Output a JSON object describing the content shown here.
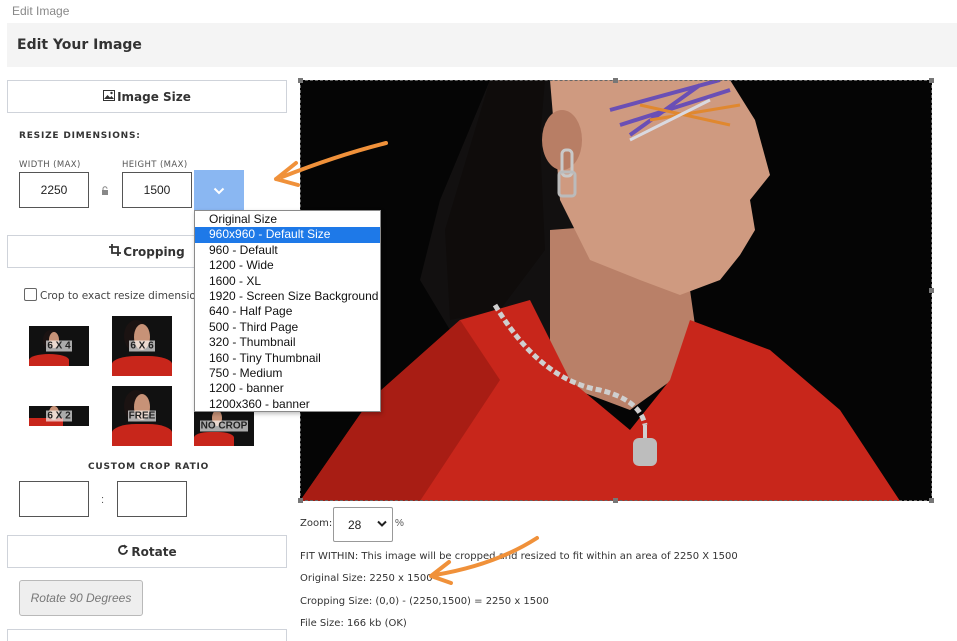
{
  "window": {
    "title": "Edit Image"
  },
  "header": {
    "title": "Edit Your Image"
  },
  "image_size": {
    "button_label": "Image Size"
  },
  "resize": {
    "heading": "RESIZE DIMENSIONS:",
    "width_label": "WIDTH (MAX)",
    "height_label": "HEIGHT (MAX)",
    "width_value": "2250",
    "height_value": "1500"
  },
  "presets": {
    "selected": "960x960 - Default Size",
    "options": [
      "Original Size",
      "960x960 - Default Size",
      "960 - Default",
      "1200 - Wide",
      "1600 - XL",
      "1920 - Screen Size Background",
      "640 - Half Page",
      "500 - Third Page",
      "320 - Thumbnail",
      "160 - Tiny Thumbnail",
      "750 - Medium",
      "1200 - banner",
      "1200x360 - banner"
    ]
  },
  "cropping": {
    "button_label": "Cropping",
    "checkbox_label": "Crop to exact resize dimensions",
    "ratios": [
      "6 X 4",
      "6 X 6",
      "6 X 2",
      "FREE",
      "NO CROP"
    ],
    "custom_heading": "CUSTOM CROP RATIO",
    "colon": ":"
  },
  "rotate": {
    "button_label": "Rotate",
    "rotate90_label": "Rotate 90 Degrees"
  },
  "zoom": {
    "label": "Zoom:",
    "value": "28",
    "suffix": "%"
  },
  "info": {
    "fit_within": "FIT WITHIN: This image will be cropped and resized to fit within an area of 2250 X 1500",
    "original_size": "Original Size: 2250 x 1500",
    "cropping_size": "Cropping Size: (0,0) - (2250,1500) = 2250 x 1500",
    "file_size": "File Size: 166 kb (OK)"
  },
  "colors": {
    "accent": "#8ab7f2",
    "selection": "#1e79e8",
    "annotation_arrow": "#f0913a",
    "dress_red": "#c8261b"
  }
}
